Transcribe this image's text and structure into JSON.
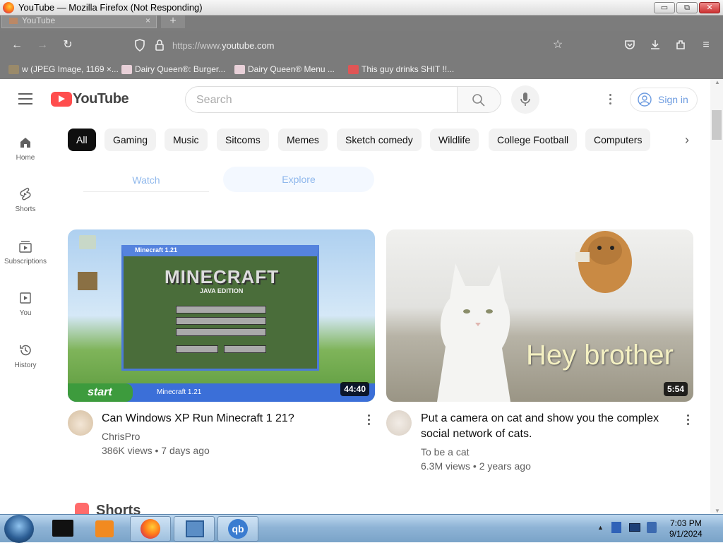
{
  "window": {
    "title": "YouTube — Mozilla Firefox (Not Responding)",
    "minimize": "▭",
    "restore": "⧉",
    "close": "✕"
  },
  "browser": {
    "tab_label": "YouTube",
    "tab_close": "×",
    "new_tab": "+",
    "url_prefix": "https://www.",
    "url_domain": "youtube.com",
    "bookmarks": [
      {
        "label": "w (JPEG Image, 1169 ×...",
        "color": "#9a8a6a"
      },
      {
        "label": "Dairy Queen®: Burger...",
        "color": "#e8d0d8"
      },
      {
        "label": "Dairy Queen® Menu ...",
        "color": "#e8d0d8"
      },
      {
        "label": "This guy drinks SHIT !!...",
        "color": "#e05555"
      }
    ]
  },
  "youtube": {
    "logo_text": "YouTube",
    "search_placeholder": "Search",
    "sign_in": "Sign in",
    "rail": [
      {
        "label": "Home",
        "icon": "home-icon"
      },
      {
        "label": "Shorts",
        "icon": "shorts-icon"
      },
      {
        "label": "Subscriptions",
        "icon": "subscriptions-icon"
      },
      {
        "label": "You",
        "icon": "you-icon"
      },
      {
        "label": "History",
        "icon": "history-icon"
      }
    ],
    "chips": [
      "All",
      "Gaming",
      "Music",
      "Sitcoms",
      "Memes",
      "Sketch comedy",
      "Wildlife",
      "College Football",
      "Computers"
    ],
    "tabs": [
      "Watch",
      "Explore"
    ],
    "videos": [
      {
        "title": "Can Windows XP Run Minecraft 1 21?",
        "channel": "ChrisPro",
        "meta": "386K views • 7 days ago",
        "duration": "44:40",
        "thumb_text": "MINECRAFT",
        "thumb_sub": "JAVA EDITION",
        "thumb_window": "Minecraft 1.21",
        "thumb_start": "start",
        "thumb_task": "Minecraft 1.21"
      },
      {
        "title_line1": "Put a camera on cat and show you the complex",
        "title_line2": "social network of cats.",
        "channel": "To be a cat",
        "meta": "6.3M views • 2 years ago",
        "duration": "5:54",
        "thumb_text": "Hey brother"
      }
    ],
    "shorts_heading": "Shorts"
  },
  "taskbar": {
    "time": "7:03 PM",
    "date": "9/1/2024"
  },
  "colors": {
    "youtube_red": "#ff0000",
    "link_blue": "#065fd4"
  }
}
